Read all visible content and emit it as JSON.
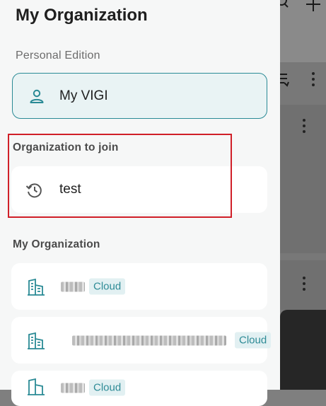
{
  "drawer": {
    "title": "My Organization",
    "personal_edition": {
      "label": "Personal Edition",
      "item": {
        "name": "My VIGI",
        "icon": "person-icon"
      }
    },
    "organization_to_join": {
      "label": "Organization to join",
      "item": {
        "name": "test",
        "icon": "history-icon"
      }
    },
    "my_organization": {
      "label": "My Organization",
      "items": [
        {
          "icon": "building-icon",
          "badge": "Cloud"
        },
        {
          "icon": "building-icon",
          "badge": "Cloud"
        },
        {
          "icon": "building-icon",
          "badge": "Cloud"
        }
      ]
    }
  },
  "colors": {
    "accent": "#2a8a95",
    "highlight_box": "#d01f28",
    "badge_bg": "#e2f0f2"
  }
}
